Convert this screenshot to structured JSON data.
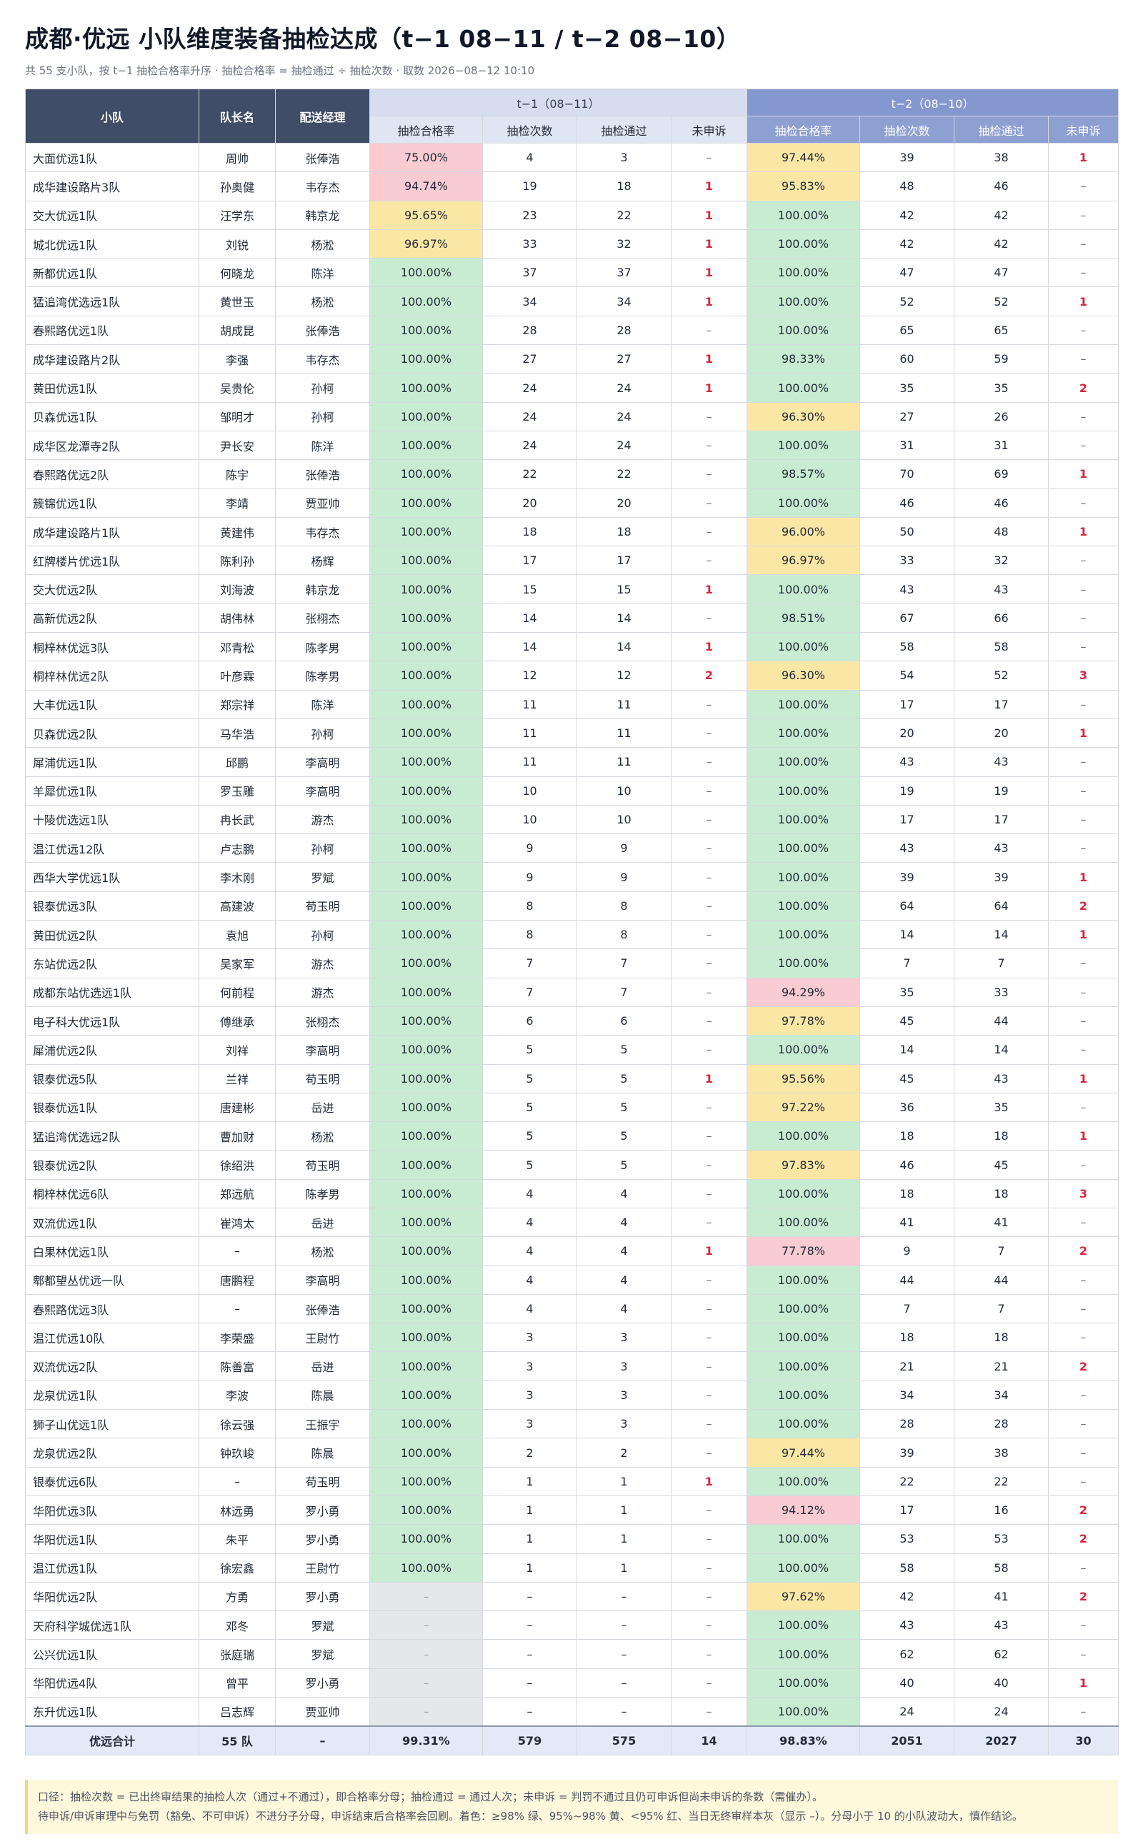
{
  "title": "成都·优远 小队维度装备抽检达成（t−1 08−11 / t−2 08−10）",
  "subtitle": "共 55 支小队，按 t−1 抽检合格率升序 · 抽检合格率 = 抽检通过 ÷ 抽检次数 · 取数 2026−08−12 10:10",
  "colors": {
    "green": "#c8ecd1",
    "yellow": "#fbe7a5",
    "red": "#f9cbd2",
    "none": "#e5e7eb",
    "header": "#3f4d66"
  },
  "headers": {
    "team": "小队",
    "leader": "队长名",
    "manager": "配送经理",
    "t1": "t−1（08−11）",
    "t2": "t−2（08−10）",
    "rate": "抽检合格率",
    "count": "抽检次数",
    "pass": "抽检通过",
    "appeal": "未申诉"
  },
  "rows": [
    [
      "大面优远1队",
      "周帅",
      "张俸浩",
      "75.00%",
      "4",
      "3",
      "–",
      "97.44%",
      "39",
      "38",
      "1"
    ],
    [
      "成华建设路片3队",
      "孙奥健",
      "韦存杰",
      "94.74%",
      "19",
      "18",
      "1",
      "95.83%",
      "48",
      "46",
      "–"
    ],
    [
      "交大优远1队",
      "汪学东",
      "韩京龙",
      "95.65%",
      "23",
      "22",
      "1",
      "100.00%",
      "42",
      "42",
      "–"
    ],
    [
      "城北优远1队",
      "刘锐",
      "杨淞",
      "96.97%",
      "33",
      "32",
      "1",
      "100.00%",
      "42",
      "42",
      "–"
    ],
    [
      "新都优远1队",
      "何晓龙",
      "陈洋",
      "100.00%",
      "37",
      "37",
      "1",
      "100.00%",
      "47",
      "47",
      "–"
    ],
    [
      "猛追湾优选远1队",
      "黄世玉",
      "杨淞",
      "100.00%",
      "34",
      "34",
      "1",
      "100.00%",
      "52",
      "52",
      "1"
    ],
    [
      "春熙路优远1队",
      "胡成昆",
      "张俸浩",
      "100.00%",
      "28",
      "28",
      "–",
      "100.00%",
      "65",
      "65",
      "–"
    ],
    [
      "成华建设路片2队",
      "李强",
      "韦存杰",
      "100.00%",
      "27",
      "27",
      "1",
      "98.33%",
      "60",
      "59",
      "–"
    ],
    [
      "黄田优远1队",
      "吴贵伦",
      "孙柯",
      "100.00%",
      "24",
      "24",
      "1",
      "100.00%",
      "35",
      "35",
      "2"
    ],
    [
      "贝森优远1队",
      "邹明才",
      "孙柯",
      "100.00%",
      "24",
      "24",
      "–",
      "96.30%",
      "27",
      "26",
      "–"
    ],
    [
      "成华区龙潭寺2队",
      "尹长安",
      "陈洋",
      "100.00%",
      "24",
      "24",
      "–",
      "100.00%",
      "31",
      "31",
      "–"
    ],
    [
      "春熙路优远2队",
      "陈宇",
      "张俸浩",
      "100.00%",
      "22",
      "22",
      "–",
      "98.57%",
      "70",
      "69",
      "1"
    ],
    [
      "簇锦优远1队",
      "李靖",
      "贾亚帅",
      "100.00%",
      "20",
      "20",
      "–",
      "100.00%",
      "46",
      "46",
      "–"
    ],
    [
      "成华建设路片1队",
      "黄建伟",
      "韦存杰",
      "100.00%",
      "18",
      "18",
      "–",
      "96.00%",
      "50",
      "48",
      "1"
    ],
    [
      "红牌楼片优远1队",
      "陈利孙",
      "杨辉",
      "100.00%",
      "17",
      "17",
      "–",
      "96.97%",
      "33",
      "32",
      "–"
    ],
    [
      "交大优远2队",
      "刘海波",
      "韩京龙",
      "100.00%",
      "15",
      "15",
      "1",
      "100.00%",
      "43",
      "43",
      "–"
    ],
    [
      "高新优远2队",
      "胡伟林",
      "张栩杰",
      "100.00%",
      "14",
      "14",
      "–",
      "98.51%",
      "67",
      "66",
      "–"
    ],
    [
      "桐梓林优远3队",
      "邓青松",
      "陈孝男",
      "100.00%",
      "14",
      "14",
      "1",
      "100.00%",
      "58",
      "58",
      "–"
    ],
    [
      "桐梓林优远2队",
      "叶彦霖",
      "陈孝男",
      "100.00%",
      "12",
      "12",
      "2",
      "96.30%",
      "54",
      "52",
      "3"
    ],
    [
      "大丰优远1队",
      "郑宗祥",
      "陈洋",
      "100.00%",
      "11",
      "11",
      "–",
      "100.00%",
      "17",
      "17",
      "–"
    ],
    [
      "贝森优远2队",
      "马华浩",
      "孙柯",
      "100.00%",
      "11",
      "11",
      "–",
      "100.00%",
      "20",
      "20",
      "1"
    ],
    [
      "犀浦优远1队",
      "邱鹏",
      "李高明",
      "100.00%",
      "11",
      "11",
      "–",
      "100.00%",
      "43",
      "43",
      "–"
    ],
    [
      "羊犀优远1队",
      "罗玉雕",
      "李高明",
      "100.00%",
      "10",
      "10",
      "–",
      "100.00%",
      "19",
      "19",
      "–"
    ],
    [
      "十陵优选远1队",
      "冉长武",
      "游杰",
      "100.00%",
      "10",
      "10",
      "–",
      "100.00%",
      "17",
      "17",
      "–"
    ],
    [
      "温江优远12队",
      "卢志鹏",
      "孙柯",
      "100.00%",
      "9",
      "9",
      "–",
      "100.00%",
      "43",
      "43",
      "–"
    ],
    [
      "西华大学优远1队",
      "李木刚",
      "罗斌",
      "100.00%",
      "9",
      "9",
      "–",
      "100.00%",
      "39",
      "39",
      "1"
    ],
    [
      "银泰优远3队",
      "高建波",
      "苟玉明",
      "100.00%",
      "8",
      "8",
      "–",
      "100.00%",
      "64",
      "64",
      "2"
    ],
    [
      "黄田优远2队",
      "袁旭",
      "孙柯",
      "100.00%",
      "8",
      "8",
      "–",
      "100.00%",
      "14",
      "14",
      "1"
    ],
    [
      "东站优远2队",
      "吴家军",
      "游杰",
      "100.00%",
      "7",
      "7",
      "–",
      "100.00%",
      "7",
      "7",
      "–"
    ],
    [
      "成都东站优选远1队",
      "何前程",
      "游杰",
      "100.00%",
      "7",
      "7",
      "–",
      "94.29%",
      "35",
      "33",
      "–"
    ],
    [
      "电子科大优远1队",
      "傅继承",
      "张栩杰",
      "100.00%",
      "6",
      "6",
      "–",
      "97.78%",
      "45",
      "44",
      "–"
    ],
    [
      "犀浦优远2队",
      "刘祥",
      "李高明",
      "100.00%",
      "5",
      "5",
      "–",
      "100.00%",
      "14",
      "14",
      "–"
    ],
    [
      "银泰优远5队",
      "兰祥",
      "苟玉明",
      "100.00%",
      "5",
      "5",
      "1",
      "95.56%",
      "45",
      "43",
      "1"
    ],
    [
      "银泰优远1队",
      "唐建彬",
      "岳进",
      "100.00%",
      "5",
      "5",
      "–",
      "97.22%",
      "36",
      "35",
      "–"
    ],
    [
      "猛追湾优选远2队",
      "曹加财",
      "杨淞",
      "100.00%",
      "5",
      "5",
      "–",
      "100.00%",
      "18",
      "18",
      "1"
    ],
    [
      "银泰优远2队",
      "徐绍洪",
      "苟玉明",
      "100.00%",
      "5",
      "5",
      "–",
      "97.83%",
      "46",
      "45",
      "–"
    ],
    [
      "桐梓林优远6队",
      "郑远航",
      "陈孝男",
      "100.00%",
      "4",
      "4",
      "–",
      "100.00%",
      "18",
      "18",
      "3"
    ],
    [
      "双流优远1队",
      "崔鸿太",
      "岳进",
      "100.00%",
      "4",
      "4",
      "–",
      "100.00%",
      "41",
      "41",
      "–"
    ],
    [
      "白果林优远1队",
      "–",
      "杨淞",
      "100.00%",
      "4",
      "4",
      "1",
      "77.78%",
      "9",
      "7",
      "2"
    ],
    [
      "郫都望丛优远一队",
      "唐鹏程",
      "李高明",
      "100.00%",
      "4",
      "4",
      "–",
      "100.00%",
      "44",
      "44",
      "–"
    ],
    [
      "春熙路优远3队",
      "–",
      "张俸浩",
      "100.00%",
      "4",
      "4",
      "–",
      "100.00%",
      "7",
      "7",
      "–"
    ],
    [
      "温江优远10队",
      "李荣盛",
      "王尉竹",
      "100.00%",
      "3",
      "3",
      "–",
      "100.00%",
      "18",
      "18",
      "–"
    ],
    [
      "双流优远2队",
      "陈善富",
      "岳进",
      "100.00%",
      "3",
      "3",
      "–",
      "100.00%",
      "21",
      "21",
      "2"
    ],
    [
      "龙泉优远1队",
      "李波",
      "陈晨",
      "100.00%",
      "3",
      "3",
      "–",
      "100.00%",
      "34",
      "34",
      "–"
    ],
    [
      "狮子山优远1队",
      "徐云强",
      "王振宇",
      "100.00%",
      "3",
      "3",
      "–",
      "100.00%",
      "28",
      "28",
      "–"
    ],
    [
      "龙泉优远2队",
      "钟玖峻",
      "陈晨",
      "100.00%",
      "2",
      "2",
      "–",
      "97.44%",
      "39",
      "38",
      "–"
    ],
    [
      "银泰优远6队",
      "–",
      "苟玉明",
      "100.00%",
      "1",
      "1",
      "1",
      "100.00%",
      "22",
      "22",
      "–"
    ],
    [
      "华阳优远3队",
      "林远勇",
      "罗小勇",
      "100.00%",
      "1",
      "1",
      "–",
      "94.12%",
      "17",
      "16",
      "2"
    ],
    [
      "华阳优远1队",
      "朱平",
      "罗小勇",
      "100.00%",
      "1",
      "1",
      "–",
      "100.00%",
      "53",
      "53",
      "2"
    ],
    [
      "温江优远1队",
      "徐宏鑫",
      "王尉竹",
      "100.00%",
      "1",
      "1",
      "–",
      "100.00%",
      "58",
      "58",
      "–"
    ],
    [
      "华阳优远2队",
      "方勇",
      "罗小勇",
      "–",
      "–",
      "–",
      "–",
      "97.62%",
      "42",
      "41",
      "2"
    ],
    [
      "天府科学城优远1队",
      "邓冬",
      "罗斌",
      "–",
      "–",
      "–",
      "–",
      "100.00%",
      "43",
      "43",
      "–"
    ],
    [
      "公兴优远1队",
      "张庭瑞",
      "罗斌",
      "–",
      "–",
      "–",
      "–",
      "100.00%",
      "62",
      "62",
      "–"
    ],
    [
      "华阳优远4队",
      "曾平",
      "罗小勇",
      "–",
      "–",
      "–",
      "–",
      "100.00%",
      "40",
      "40",
      "1"
    ],
    [
      "东升优远1队",
      "吕志辉",
      "贾亚帅",
      "–",
      "–",
      "–",
      "–",
      "100.00%",
      "24",
      "24",
      "–"
    ]
  ],
  "total": [
    "优远合计",
    "55 队",
    "–",
    "99.31%",
    "579",
    "575",
    "14",
    "98.83%",
    "2051",
    "2027",
    "30"
  ],
  "notes": [
    "口径：抽检次数 = 已出终审结果的抽检人次（通过+不通过），即合格率分母；抽检通过 = 通过人次；未申诉 = 判罚不通过且仍可申诉但尚未申诉的条数（需催办）。",
    "待申诉/申诉审理中与免罚（豁免、不可申诉）不进分子分母，申诉结束后合格率会回刷。着色：≥98% 绿、95%~98% 黄、<95% 红、当日无终审样本灰（显示 –）。分母小于 10 的小队波动大，慎作结论。"
  ]
}
